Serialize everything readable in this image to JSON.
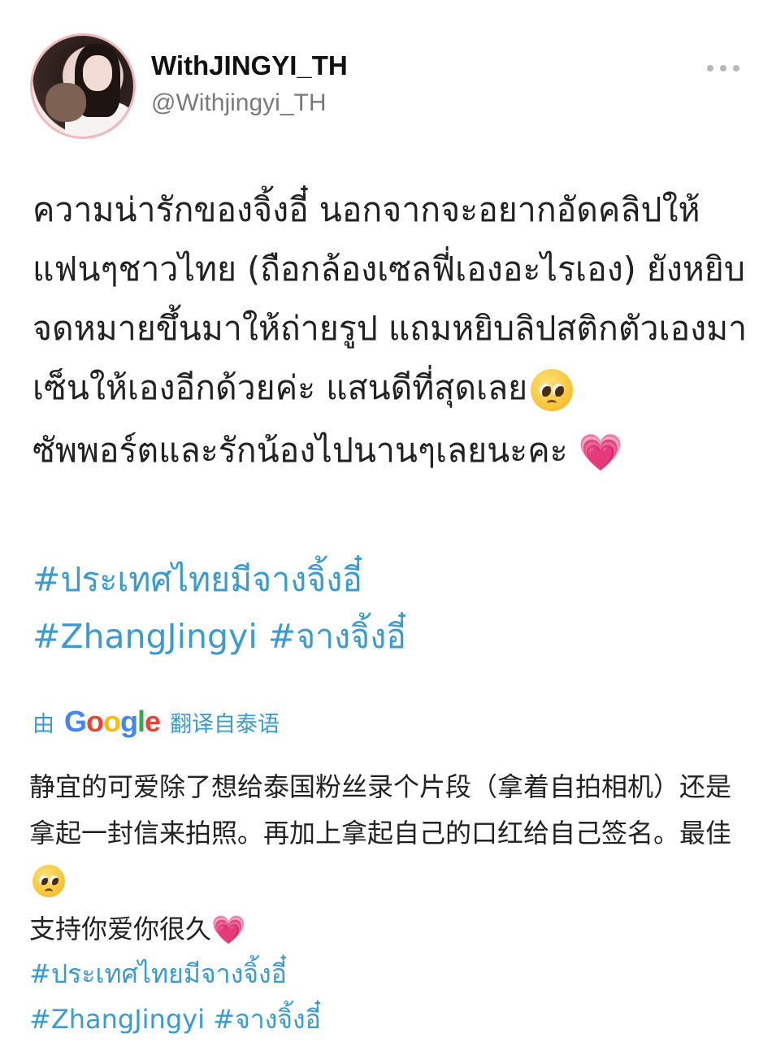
{
  "header": {
    "display_name": "WithJINGYI_TH",
    "handle": "@Withjingyi_TH",
    "more_icon": "more-horizontal-icon"
  },
  "tweet": {
    "paragraph1": "ความน่ารักของจิ้งอี๋ นอกจากจะอยากอัดคลิปให้แฟนๆชาวไทย (ถือกล้องเซลฟี่เองอะไรเอง) ยังหยิบจดหมายขึ้นมาให้ถ่ายรูป แถมหยิบลิปสติกตัวเองมาเซ็นให้เองอีกด้วยค่ะ แสนดีที่สุดเลย",
    "paragraph2": "ซัพพอร์ตและรักน้องไปนานๆเลยนะคะ ",
    "hashtags": [
      "#ประเทศไทยมีจางจิ้งอี๋",
      "#ZhangJingyi",
      "#จางจิ้งอี๋"
    ]
  },
  "translate": {
    "prefix": "由",
    "brand": [
      "G",
      "o",
      "o",
      "g",
      "l",
      "e"
    ],
    "suffix": "翻译自泰语"
  },
  "translation": {
    "paragraph1": "静宜的可爱除了想给泰国粉丝录个片段（拿着自拍相机）还是拿起一封信来拍照。再加上拿起自己的口红给自己签名。最佳",
    "paragraph2": "支持你爱你很久",
    "hashtags": [
      "#ประเทศไทยมีจางจิ้งอี๋",
      "#ZhangJingyi",
      "#จางจิ้งอี๋"
    ]
  },
  "colors": {
    "link": "#3a9bd1",
    "handle_gray": "#7a7a7a"
  },
  "icons": {
    "emoji1": "pleading-face-icon",
    "emoji2": "growing-heart-icon"
  }
}
